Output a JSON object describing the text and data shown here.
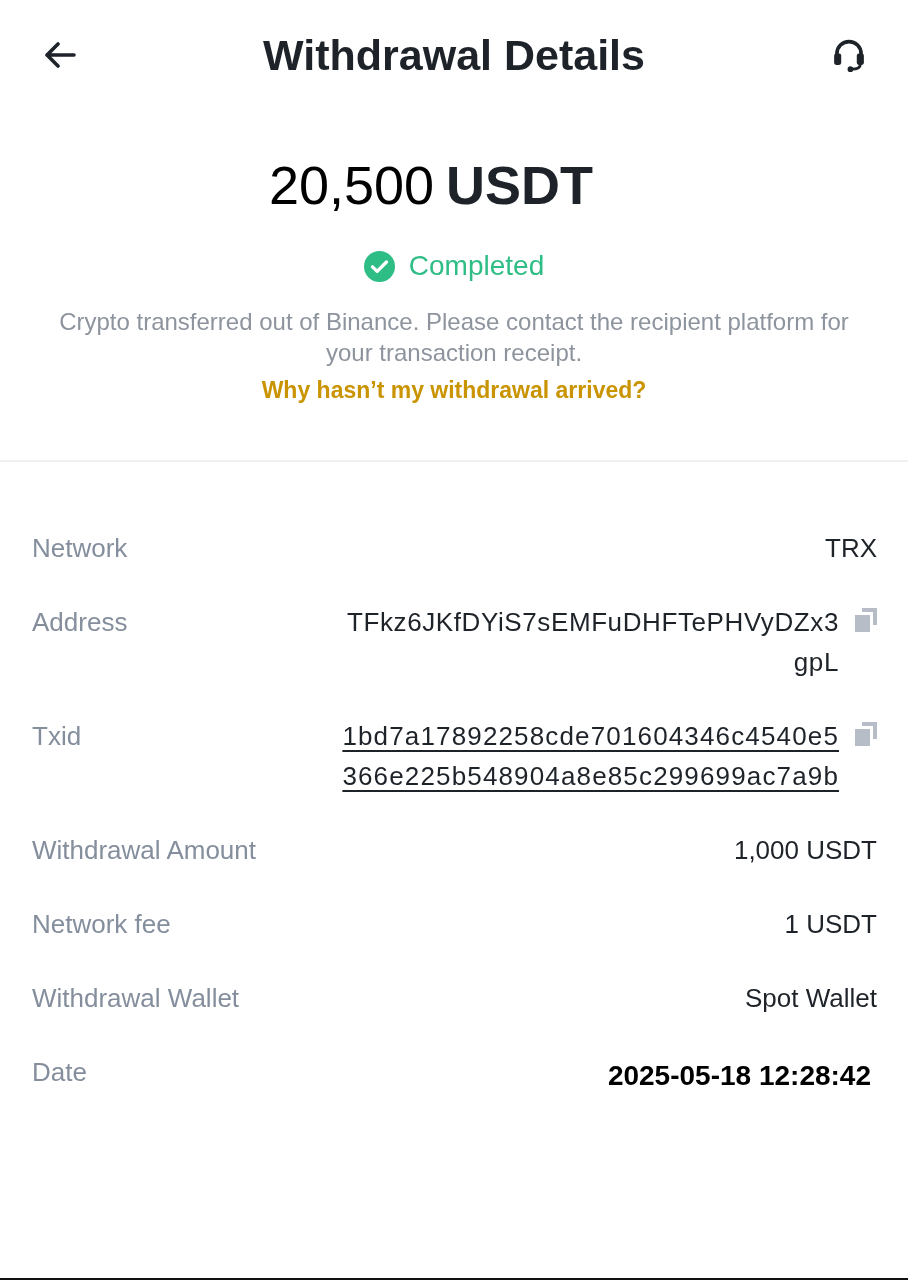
{
  "header": {
    "title": "Withdrawal Details"
  },
  "summary": {
    "amount": "20,500",
    "currency": "USDT",
    "status": {
      "label": "Completed",
      "kind": "success"
    },
    "note": "Crypto transferred out of Binance. Please contact the recipient platform for your transaction receipt.",
    "help_link": "Why hasn’t my withdrawal arrived?"
  },
  "details": [
    {
      "label": "Network",
      "value": "TRX",
      "kind": "text"
    },
    {
      "label": "Address",
      "value": "TFkz6JKfDYiS7sEMFuDHFTePHVyDZx3gpL",
      "kind": "copy"
    },
    {
      "label": "Txid",
      "value": "1bd7a17892258cde701604346c4540e5366e225b548904a8e85c299699ac7a9b",
      "kind": "link"
    },
    {
      "label": "Withdrawal Amount",
      "value": "1,000 USDT",
      "kind": "text"
    },
    {
      "label": "Network fee",
      "value": "1 USDT",
      "kind": "text"
    },
    {
      "label": "Withdrawal Wallet",
      "value": "Spot Wallet",
      "kind": "text"
    },
    {
      "label": "Date",
      "value": "2025-05-18 12:28:42",
      "kind": "date"
    }
  ]
}
